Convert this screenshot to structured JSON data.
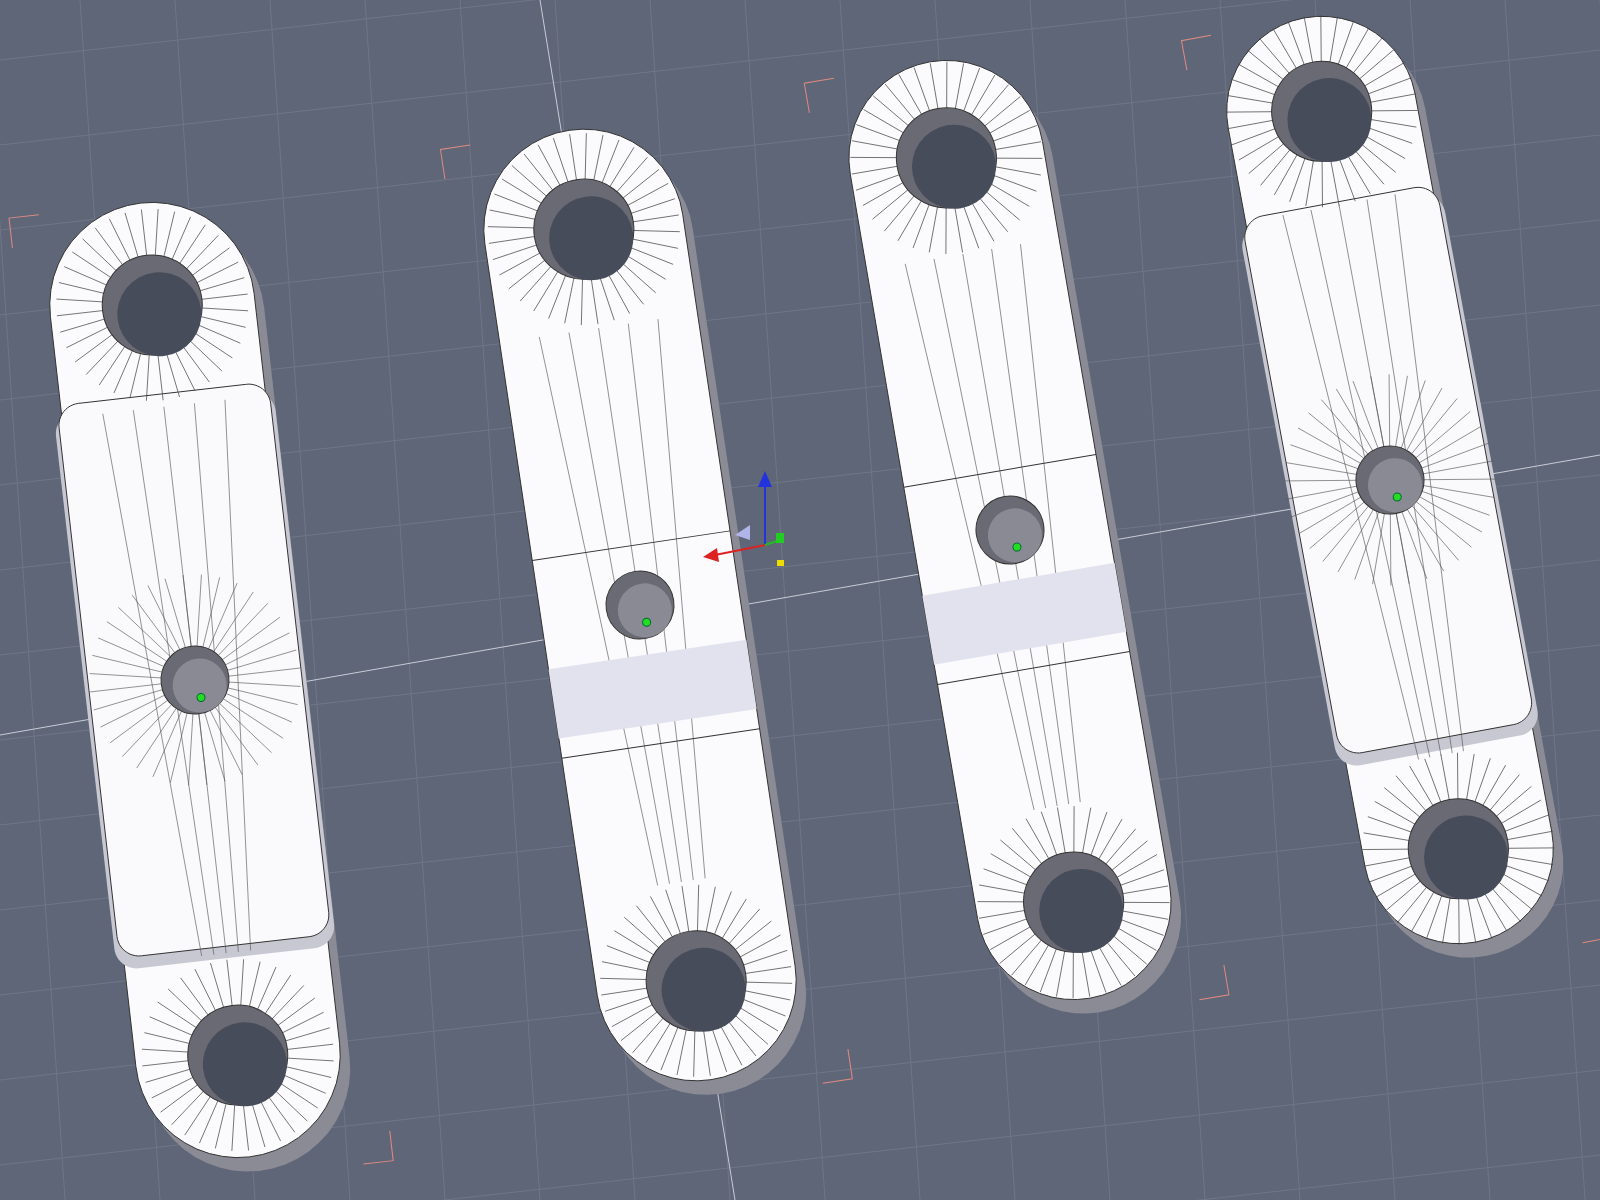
{
  "viewport": {
    "parts": [
      {
        "kind": "raised",
        "selected": false
      },
      {
        "kind": "flat",
        "selected": true
      },
      {
        "kind": "flat",
        "selected": false
      },
      {
        "kind": "raised",
        "selected": false
      }
    ]
  }
}
